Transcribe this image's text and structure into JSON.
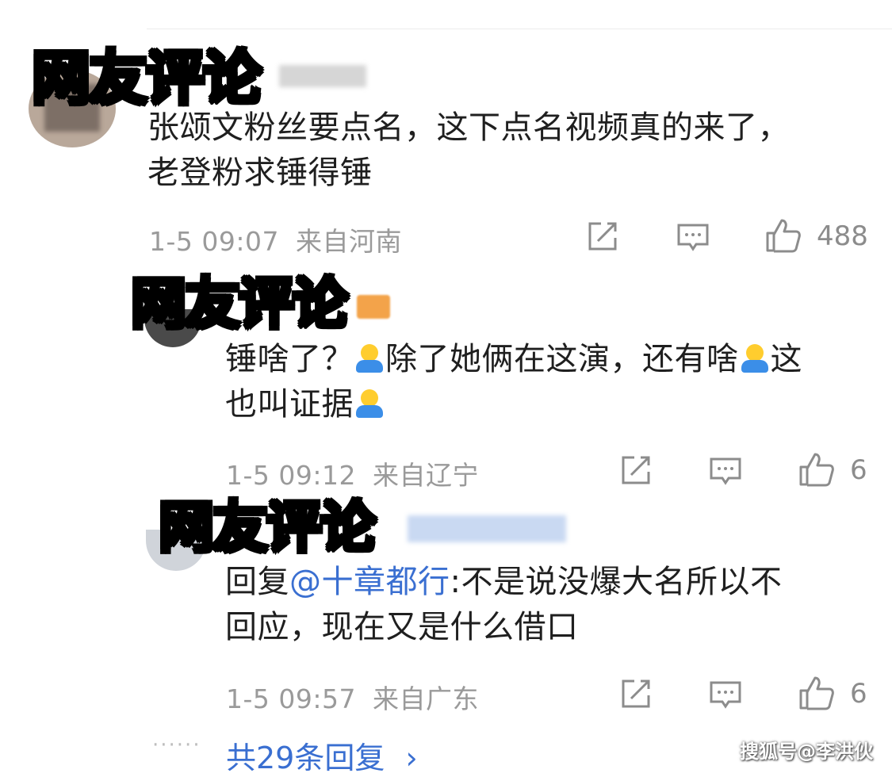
{
  "comments": [
    {
      "overlay_label": "网友评论",
      "body_line1": "张颂文粉丝要点名，这下点名视频真的来了，",
      "body_line2": "老登粉求锤得锤",
      "time": "1-5 09:07",
      "location": "来自河南",
      "likes": "488"
    },
    {
      "overlay_label": "网友评论",
      "body_part1": "锤啥了？",
      "body_part2": "除了她俩在这演，还有啥",
      "body_part3": "这",
      "body_part4": "也叫证据",
      "time": "1-5 09:12",
      "location": "来自辽宁",
      "likes": "6"
    },
    {
      "overlay_label": "网友评论",
      "reply_prefix": "回复",
      "mention": "@十章都行",
      "body_rest": ":不是说没爆大名所以不",
      "body_line2": "回应，现在又是什么借口",
      "time": "1-5 09:57",
      "location": "来自广东",
      "likes": "6"
    }
  ],
  "footer": {
    "dots": "······",
    "replies_link": "共29条回复",
    "chevron": "›",
    "watermark": "搜狐号@李洪伙"
  },
  "icons": [
    "share-icon",
    "comment-icon",
    "like-icon"
  ],
  "colors": {
    "overlay": "#ffde00",
    "link": "#3a6fd1",
    "meta": "#9a9a9a",
    "emoji_face": "#ffcd2e",
    "emoji_shirt": "#3b8ee8"
  }
}
